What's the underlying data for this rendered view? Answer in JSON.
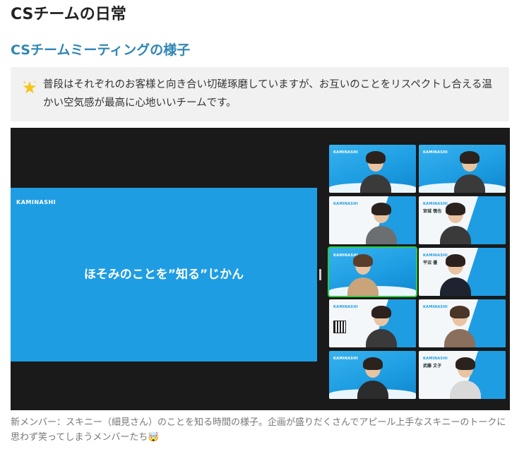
{
  "page_title": "CSチームの日常",
  "section_title": "CSチームミーティングの様子",
  "note": {
    "icon": "sparkle-star-icon",
    "text": "普段はそれぞれのお客様と向き合い切磋琢磨していますが、お互いのことをリスペクトし合える温かい空気感が最高に心地いいチームです。"
  },
  "meeting_screen": {
    "slide": {
      "logo": "KAMINASHI",
      "title": "ほそみのことを”知る”じかん"
    },
    "tiles": [
      {
        "logo": "KAMINASHI",
        "name": "",
        "style": "blue"
      },
      {
        "logo": "KAMINASHI",
        "name": "",
        "style": "blue"
      },
      {
        "logo": "KAMINASHI",
        "name": "",
        "style": "white"
      },
      {
        "logo": "KAMINASHI",
        "name": "宮城 慎也",
        "style": "white"
      },
      {
        "logo": "KAMINASHI",
        "name": "",
        "style": "blue"
      },
      {
        "logo": "KAMINASHI",
        "name": "平沼 優",
        "style": "white"
      },
      {
        "logo": "KAMINASHI",
        "name": "",
        "style": "white"
      },
      {
        "logo": "KAMINASHI",
        "name": "",
        "style": "white"
      },
      {
        "logo": "KAMINASHI",
        "name": "",
        "style": "blue"
      },
      {
        "logo": "KAMINASHI",
        "name": "武藤 文子",
        "style": "white"
      }
    ]
  },
  "caption": "新メンバー：スキニー（細見さん）のことを知る時間の様子。企画が盛りだくさんでアピール上手なスキニーのトークに思わず笑ってしまうメンバーたち🤯",
  "colors": {
    "accent": "#2f86b5",
    "slide_bg": "#1e9de3",
    "screen_bg": "#1a1a1a",
    "note_bg": "#f1f1f1",
    "speaking_border": "#2ecc40"
  }
}
